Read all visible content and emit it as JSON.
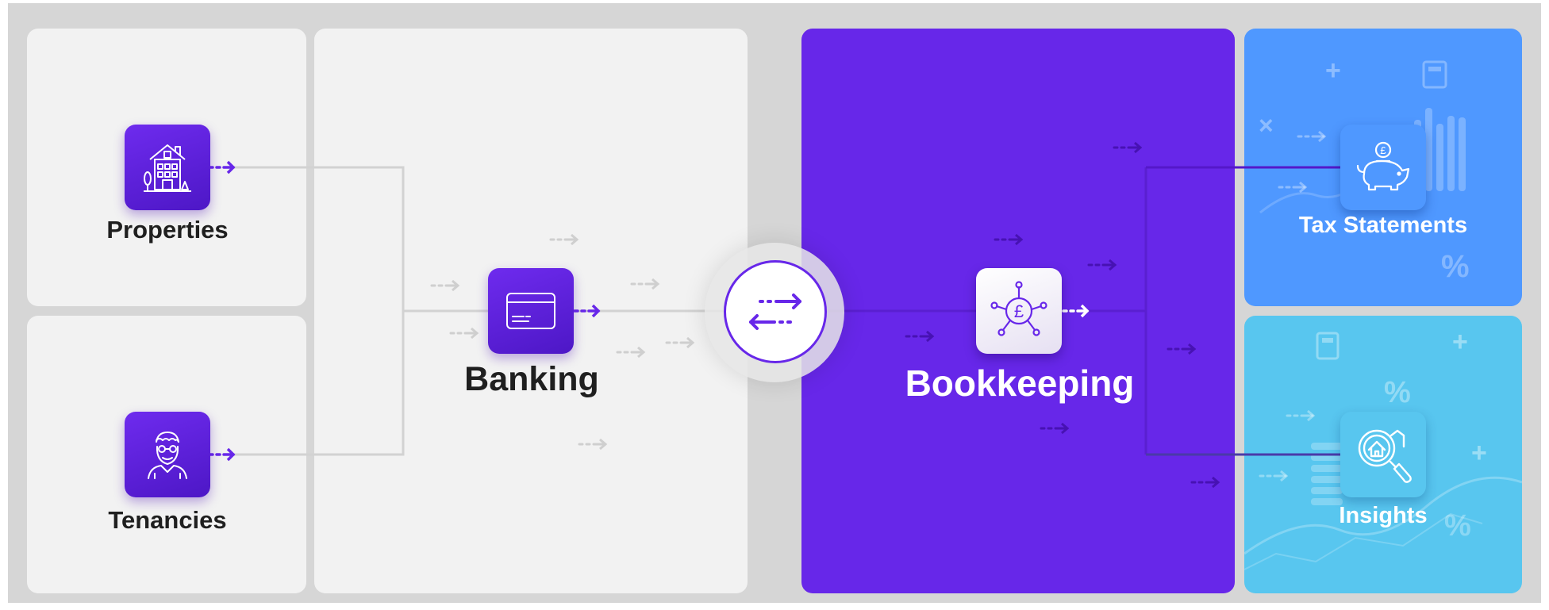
{
  "nodes": {
    "properties": {
      "label": "Properties",
      "icon": "house-icon"
    },
    "tenancies": {
      "label": "Tenancies",
      "icon": "tenant-person-icon"
    },
    "banking": {
      "label": "Banking",
      "icon": "bank-card-icon"
    },
    "exchange": {
      "icon": "bidirectional-arrows-icon"
    },
    "bookkeeping": {
      "label": "Bookkeeping",
      "icon": "pound-network-icon"
    },
    "tax_statements": {
      "label": "Tax Statements",
      "icon": "piggy-bank-icon"
    },
    "insights": {
      "label": "Insights",
      "icon": "house-search-icon"
    }
  },
  "background_symbols": {
    "tax": [
      "+",
      "×",
      "%"
    ],
    "insights": [
      "+",
      "%",
      "+",
      "%"
    ]
  },
  "colors": {
    "purple": "#6727e9",
    "blue": "#4f98ff",
    "cyan": "#58c6ef",
    "light_panel": "#f2f2f2",
    "text_dark": "#1f1f1f"
  }
}
